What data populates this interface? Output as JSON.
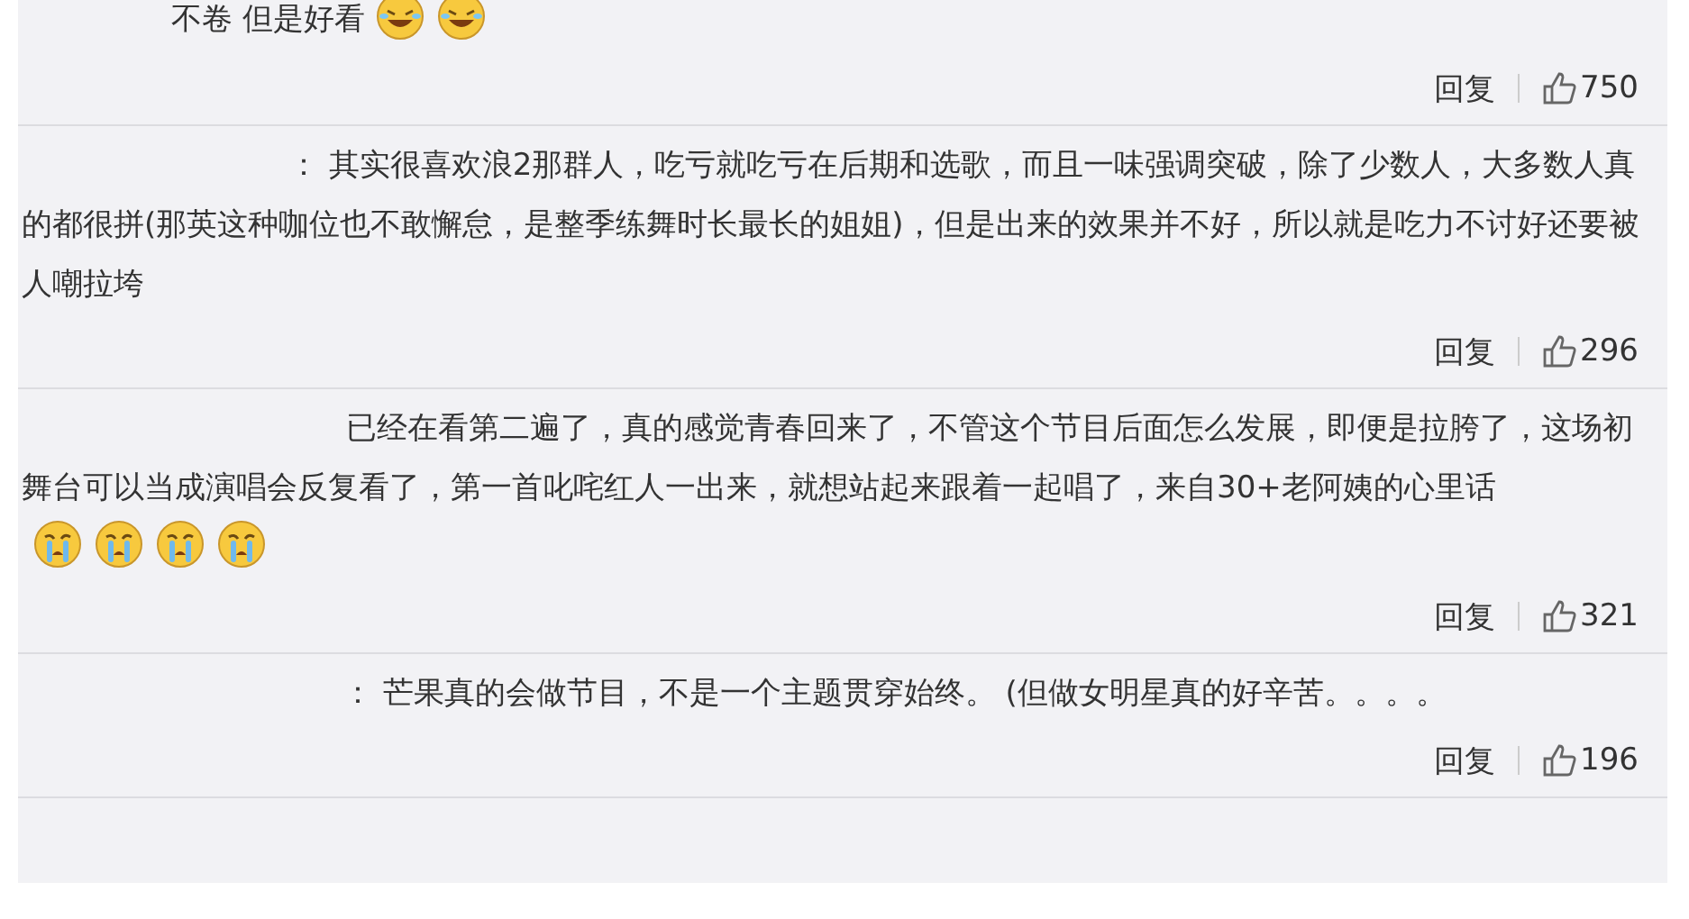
{
  "comments": [
    {
      "text": "不卷 但是好看",
      "emojis": [
        {
          "kind": "laughing"
        },
        {
          "kind": "laughing"
        }
      ],
      "reply": "回复",
      "likes": "750"
    },
    {
      "text": "： 其实很喜欢浪2那群人，吃亏就吃亏在后期和选歌，而且一味强调突破，除了少数人，大多数人真的都很拼(那英这种咖位也不敢懈怠，是整季练舞时长最长的姐姐)，但是出来的效果并不好，所以就是吃力不讨好还要被人嘲拉垮",
      "reply": "回复",
      "likes": "296"
    },
    {
      "text": "已经在看第二遍了，真的感觉青春回来了，不管这个节目后面怎么发展，即便是拉胯了，这场初舞台可以当成演唱会反复看了，第一首叱咤红人一出来，就想站起来跟着一起唱了，来自30+老阿姨的心里话",
      "emojis": [
        {
          "kind": "crying"
        },
        {
          "kind": "crying"
        },
        {
          "kind": "crying"
        },
        {
          "kind": "crying"
        }
      ],
      "reply": "回复",
      "likes": "321"
    },
    {
      "text": "：  芒果真的会做节目，不是一个主题贯穿始终。 (但做女明星真的好辛苦。。。。",
      "reply": "回复",
      "likes": "196"
    }
  ]
}
